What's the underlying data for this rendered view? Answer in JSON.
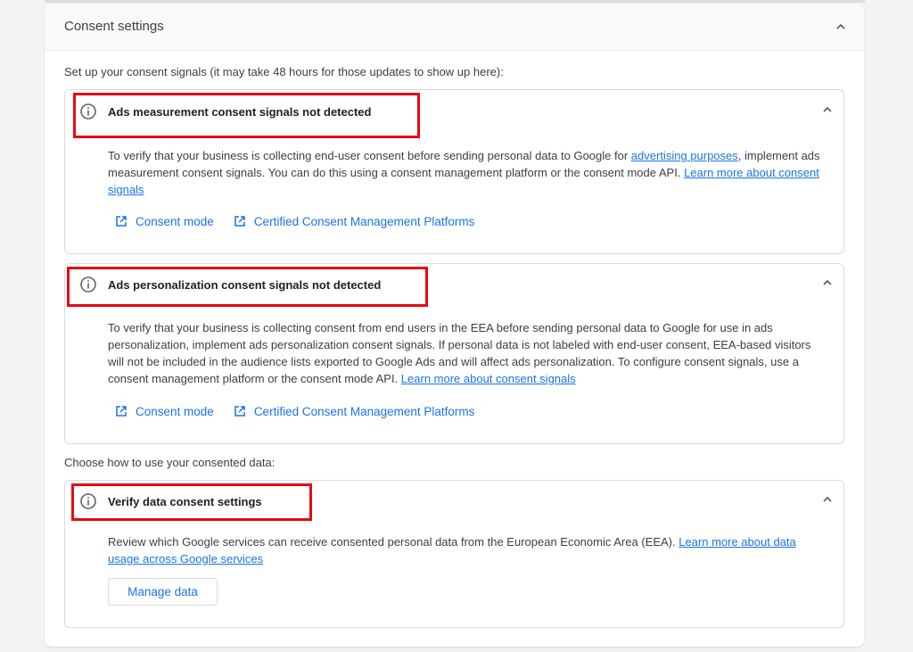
{
  "panel": {
    "title": "Consent settings",
    "intro": "Set up your consent signals (it may take 48 hours for those updates to show up here):",
    "choose_label": "Choose how to use your consented data:"
  },
  "cards": [
    {
      "title": "Ads measurement consent signals not detected",
      "desc_pre": "To verify that your business is collecting end-user consent before sending personal data to Google for ",
      "desc_link1": "advertising purposes",
      "desc_mid": ", implement ads measurement consent signals. You can do this using a consent management platform or the consent mode API. ",
      "desc_link2": "Learn more about consent signals",
      "link_consent_mode": "Consent mode",
      "link_cmp": "Certified Consent Management Platforms"
    },
    {
      "title": "Ads personalization consent signals not detected",
      "desc_pre": "To verify that your business is collecting consent from end users in the EEA before sending personal data to Google for use in ads personalization, implement ads personalization consent signals. If personal data is not labeled with end-user consent, EEA-based visitors will not be included in the audience lists exported to Google Ads and will affect ads personalization. To configure consent signals, use a consent management platform or the consent mode API. ",
      "desc_link2": "Learn more about consent signals",
      "link_consent_mode": "Consent mode",
      "link_cmp": "Certified Consent Management Platforms"
    },
    {
      "title": "Verify data consent settings",
      "desc_pre": "Review which Google services can receive consented personal data from the European Economic Area (EEA). ",
      "desc_link2": "Learn more about data usage across Google services",
      "button": "Manage data"
    }
  ],
  "colors": {
    "link": "#1a73e8",
    "highlight": "#e50914",
    "border": "#dadce0"
  },
  "icons": [
    "chevron-up-icon",
    "info-icon",
    "open-in-new-icon"
  ]
}
